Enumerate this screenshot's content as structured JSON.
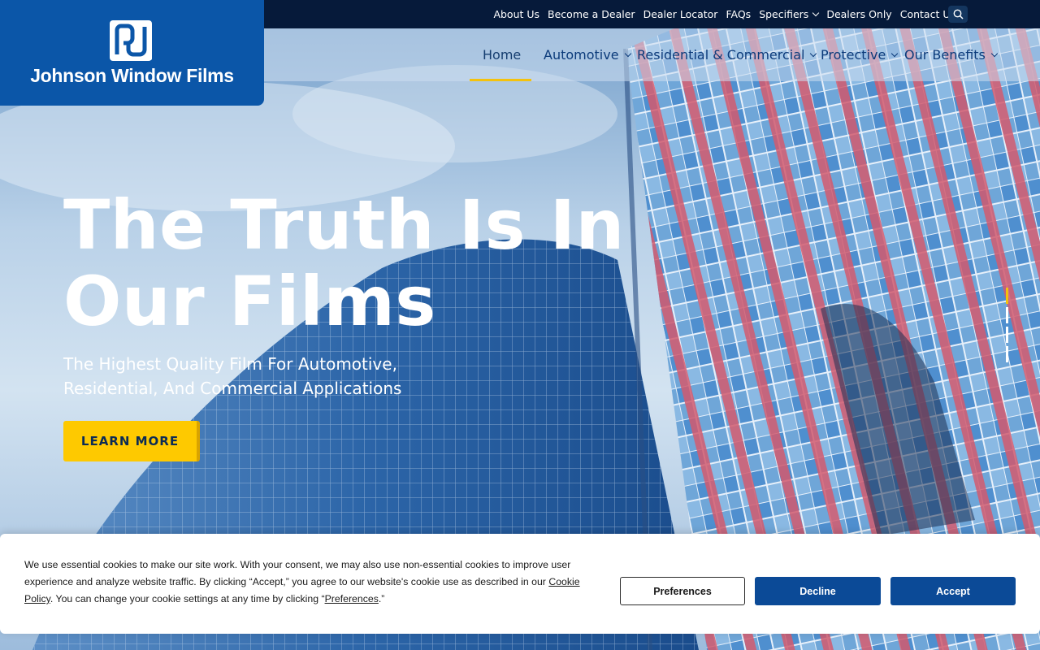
{
  "brand": {
    "name": "Johnson Window Films",
    "registered": "®"
  },
  "top_nav": [
    {
      "label": "About Us",
      "has_dropdown": false
    },
    {
      "label": "Become a Dealer",
      "has_dropdown": false
    },
    {
      "label": "Dealer Locator",
      "has_dropdown": false
    },
    {
      "label": "FAQs",
      "has_dropdown": false
    },
    {
      "label": "Specifiers",
      "has_dropdown": true
    },
    {
      "label": "Dealers Only",
      "has_dropdown": false
    },
    {
      "label": "Contact Us",
      "has_dropdown": true
    }
  ],
  "search_icon": "search-icon",
  "main_nav": [
    {
      "label": "Home",
      "active": true
    },
    {
      "label": "Automotive",
      "has_dropdown": true
    },
    {
      "label": "Residential & Commercial",
      "has_dropdown": true
    },
    {
      "label": "Protective",
      "has_dropdown": true
    },
    {
      "label": "Our Benefits",
      "has_dropdown": true
    }
  ],
  "hero": {
    "title_line1": "The Truth Is In",
    "title_line2": "Our Films",
    "subtitle_line1": "The Highest Quality Film For Automotive,",
    "subtitle_line2": "Residential, And Commercial Applications",
    "cta_label": "LEARN MORE",
    "slides_total": 4,
    "slide_active": 1
  },
  "cookie_banner": {
    "text_part1": "We use essential cookies to make our site work. With your consent, we may also use non-essential cookies to improve user experience and analyze website traffic. By clicking “Accept,” you agree to our website's cookie use as described in our ",
    "policy_link": "Cookie Policy",
    "text_part2": ". You can change your cookie settings at any time by clicking “",
    "preferences_link": "Preferences",
    "text_part3": ".”",
    "preferences_button": "Preferences",
    "decline_button": "Decline",
    "accept_button": "Accept"
  },
  "colors": {
    "brand_blue": "#0b56a8",
    "topbar_navy": "#061a3a",
    "accent_yellow": "#fec900",
    "button_blue": "#0b4a97"
  }
}
